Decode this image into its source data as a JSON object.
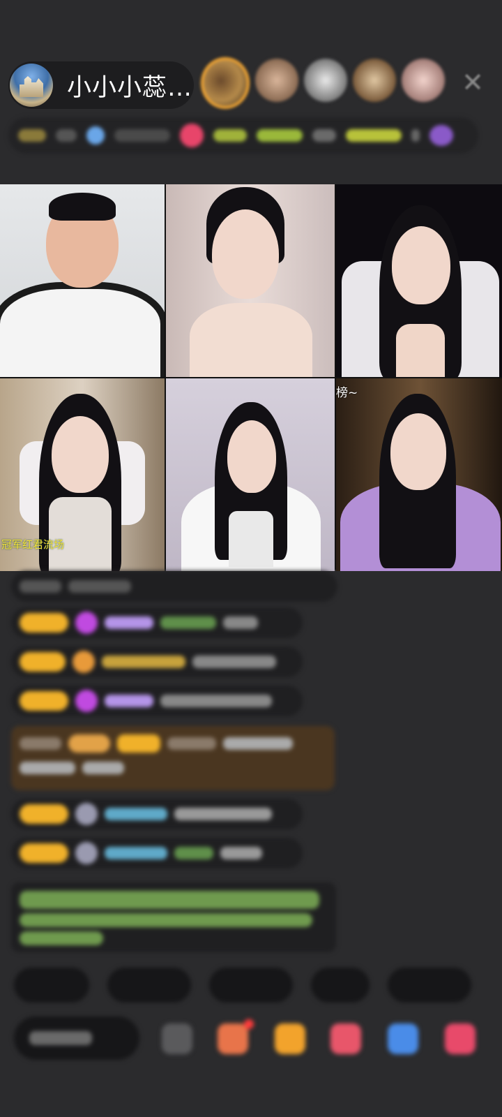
{
  "header": {
    "host_name": "小小小蕊…",
    "close_icon": "close-icon"
  },
  "video_grid": {
    "captions": {
      "tile4": "冠军红君流场",
      "tile6": "榜~"
    }
  },
  "colors": {
    "background": "#2b2b2d",
    "badge_gold": "#f0b12a",
    "highlight_brown": "#4a3620",
    "notice_green": "#9ad36b",
    "name_purple": "#b494e8",
    "name_teal": "#5fa9c8"
  }
}
